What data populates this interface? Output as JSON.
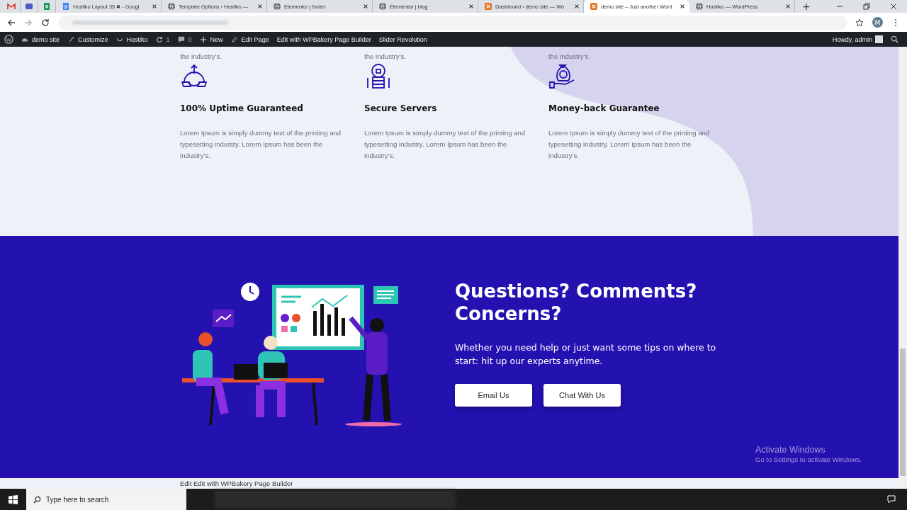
{
  "browser": {
    "tabs": [
      {
        "kind": "app",
        "selected": false
      },
      {
        "kind": "app",
        "selected": false
      },
      {
        "kind": "app",
        "selected": false
      },
      {
        "kind": "page",
        "title": "Hostiko Layout 35 ✖ - Googl",
        "selected": false
      },
      {
        "kind": "page",
        "title": "Template Options ‹ Hostiko —",
        "selected": false
      },
      {
        "kind": "page",
        "title": "Elementor | footer",
        "selected": false
      },
      {
        "kind": "page",
        "title": "Elementor | blog",
        "selected": false
      },
      {
        "kind": "page",
        "title": "Dashboard ‹ demo site — Wo",
        "selected": false
      },
      {
        "kind": "page",
        "title": "demo site – Just another Word",
        "selected": true
      },
      {
        "kind": "page",
        "title": "Hostiko — WordPress",
        "selected": false
      }
    ],
    "new_tab": "+",
    "profile": "M"
  },
  "admin_bar": {
    "items": [
      "demo site",
      "Customize",
      "Hostiko",
      "1",
      "0",
      "New",
      "Edit Page",
      "Edit with WPBakery Page Builder",
      "Slider Revolution"
    ],
    "greeting": "Howdy, admin"
  },
  "features": {
    "previous_row": [
      "the industry’s.",
      "the industry’s.",
      "the industry’s."
    ],
    "items": [
      {
        "title": "100% Uptime Guaranteed",
        "text": "Lorem Ipsum is simply dummy text of the printing and typesetting industry. Lorem Ipsum has been the industry’s."
      },
      {
        "title": "Secure Servers",
        "text": "Lorem Ipsum is simply dummy text of the printing and typesetting industry. Lorem Ipsum has been the industry’s."
      },
      {
        "title": "Money-back Guarantee",
        "text": "Lorem Ipsum is simply dummy text of the printing and typesetting industry. Lorem Ipsum has been the industry’s."
      }
    ]
  },
  "cta": {
    "heading": "Questions? Comments? Concerns?",
    "text": "Whether you need help or just want some tips on where to start: hit up our experts anytime.",
    "buttons": [
      "Email Us",
      "Chat With Us"
    ]
  },
  "activation": {
    "title": "Activate Windows",
    "subtitle": "Go to Settings to activate Windows."
  },
  "edit_bar": "Edit Edit with WPBakery Page Builder",
  "taskbar": {
    "search_placeholder": "Type here to search"
  }
}
